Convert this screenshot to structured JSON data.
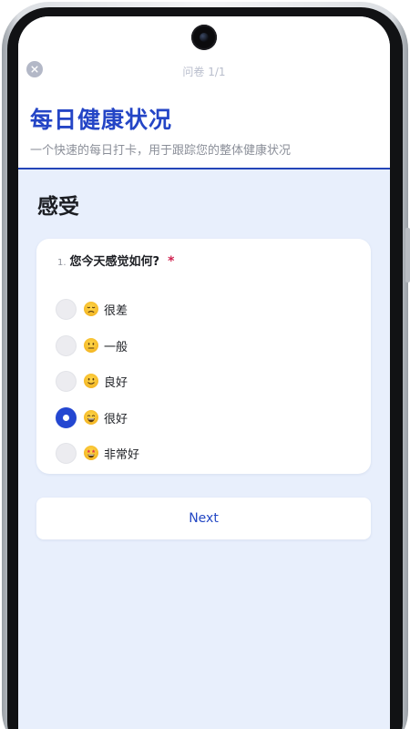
{
  "header": {
    "progress": "问卷 1/1",
    "title": "每日健康状况",
    "description": "一个快速的每日打卡，用于跟踪您的整体健康状况"
  },
  "section": {
    "title": "感受"
  },
  "question": {
    "number": "1.",
    "text": "您今天感觉如何?",
    "required_mark": "*",
    "options": [
      {
        "label": "很差",
        "icon": "disappointed-face-icon",
        "selected": false
      },
      {
        "label": "一般",
        "icon": "neutral-face-icon",
        "selected": false
      },
      {
        "label": "良好",
        "icon": "slightly-smiling-face-icon",
        "selected": false
      },
      {
        "label": "很好",
        "icon": "grinning-face-icon",
        "selected": true
      },
      {
        "label": "非常好",
        "icon": "star-struck-face-icon",
        "selected": false
      }
    ]
  },
  "actions": {
    "next_label": "Next"
  },
  "colors": {
    "accent": "#2445c6",
    "required": "#d0214f",
    "background": "#e8effc"
  }
}
